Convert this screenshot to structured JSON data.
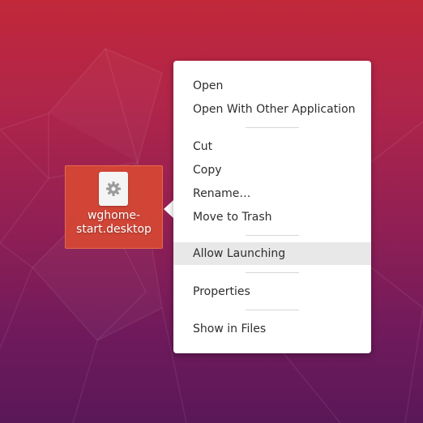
{
  "desktop": {
    "icon": {
      "icon_name": "gear-icon",
      "label_line1": "wghome-",
      "label_line2": "start.desktop"
    }
  },
  "context_menu": {
    "groups": [
      {
        "items": [
          {
            "label": "Open"
          },
          {
            "label": "Open With Other Application"
          }
        ]
      },
      {
        "items": [
          {
            "label": "Cut"
          },
          {
            "label": "Copy"
          },
          {
            "label": "Rename…"
          },
          {
            "label": "Move to Trash"
          }
        ]
      },
      {
        "items": [
          {
            "label": "Allow Launching",
            "highlighted": true
          }
        ]
      },
      {
        "items": [
          {
            "label": "Properties"
          }
        ]
      },
      {
        "items": [
          {
            "label": "Show in Files"
          }
        ]
      }
    ]
  },
  "colors": {
    "background_top": "#c1283a",
    "background_bottom": "#5a1858",
    "icon_selection": "#d64834",
    "menu_background": "#ffffff",
    "menu_highlight": "#e8e8e8"
  }
}
